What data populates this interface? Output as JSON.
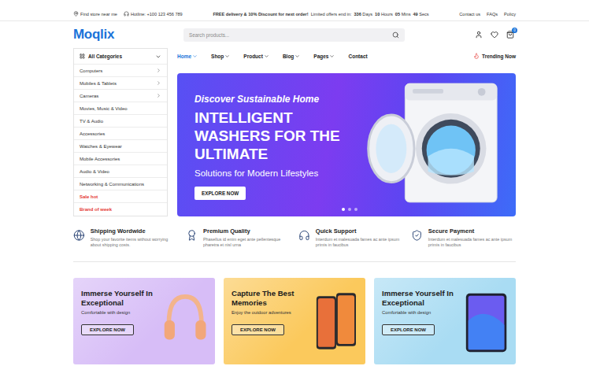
{
  "topbar": {
    "store_locator": "Find store near me",
    "hotline": "Hotline: +100 123 456 789",
    "promo": "FREE delivery & 10% Discount for next order!",
    "offer_label": "Limited offers end in:",
    "countdown": [
      {
        "value": "336",
        "unit": "Days"
      },
      {
        "value": "10",
        "unit": "Hours"
      },
      {
        "value": "05",
        "unit": "Mins"
      },
      {
        "value": "49",
        "unit": "Secs"
      }
    ],
    "links": [
      "Contact us",
      "FAQs",
      "Policy"
    ]
  },
  "header": {
    "logo": "Moqlix",
    "search": {
      "placeholder": "Search products..."
    },
    "cart_count": "0"
  },
  "categories": {
    "title": "All Categories",
    "items": [
      {
        "label": "Computers",
        "has_submenu": true,
        "kind": "normal"
      },
      {
        "label": "Mobiles & Tablets",
        "has_submenu": true,
        "kind": "normal"
      },
      {
        "label": "Cameras",
        "has_submenu": true,
        "kind": "normal"
      },
      {
        "label": "Movies, Music & Video",
        "has_submenu": false,
        "kind": "normal"
      },
      {
        "label": "TV & Audio",
        "has_submenu": false,
        "kind": "normal"
      },
      {
        "label": "Accessories",
        "has_submenu": false,
        "kind": "normal"
      },
      {
        "label": "Watches & Eyewear",
        "has_submenu": false,
        "kind": "normal"
      },
      {
        "label": "Mobile Accessories",
        "has_submenu": false,
        "kind": "normal"
      },
      {
        "label": "Audio & Video",
        "has_submenu": false,
        "kind": "normal"
      },
      {
        "label": "Networking & Communications",
        "has_submenu": false,
        "kind": "normal"
      },
      {
        "label": "Sale hot",
        "has_submenu": false,
        "kind": "promo"
      },
      {
        "label": "Brand of week",
        "has_submenu": false,
        "kind": "promo"
      }
    ]
  },
  "nav": {
    "items": [
      {
        "label": "Home",
        "selected": true,
        "dropdown": true
      },
      {
        "label": "Shop",
        "selected": false,
        "dropdown": true
      },
      {
        "label": "Product",
        "selected": false,
        "dropdown": true
      },
      {
        "label": "Blog",
        "selected": false,
        "dropdown": true
      },
      {
        "label": "Pages",
        "selected": false,
        "dropdown": true
      },
      {
        "label": "Contact",
        "selected": false,
        "dropdown": false
      }
    ],
    "trending": "Trending Now"
  },
  "hero": {
    "eyebrow": "Discover Sustainable Home",
    "title": "INTELLIGENT WASHERS FOR THE ULTIMATE",
    "subtitle": "Solutions for Modern Lifestyles",
    "button": "EXPLORE NOW",
    "slides": [
      {
        "selected": true
      },
      {
        "selected": false
      },
      {
        "selected": false
      }
    ]
  },
  "features": [
    {
      "title": "Shipping Wordwide",
      "text": "Shop your favorite items without worrying about shipping costs."
    },
    {
      "title": "Premium Quality",
      "text": "Phasellus id enim eget ante pellentesque pharetra et nisl urna"
    },
    {
      "title": "Quick Support",
      "text": "Interdum et malesuada fames ac ante ipsum primis in faucibus"
    },
    {
      "title": "Secure Payment",
      "text": "Interdum et malesuada fames ac ante ipsum primis in faucibus"
    }
  ],
  "promos": [
    {
      "title": "Immerse Yourself In Exceptional",
      "subtitle": "Comfortable with design",
      "button": "EXPLORE NOW",
      "color": "#d7bdf7",
      "kind": "headphones"
    },
    {
      "title": "Capture The Best Memories",
      "subtitle": "Enjoy the outdoor adventures",
      "button": "EXPLORE NOW",
      "color": "#fbc95c",
      "kind": "phones"
    },
    {
      "title": "Immerse Yourself In Exceptional",
      "subtitle": "Comfortable with design",
      "button": "EXPLORE NOW",
      "color": "#a9dcf3",
      "kind": "tablet"
    }
  ]
}
